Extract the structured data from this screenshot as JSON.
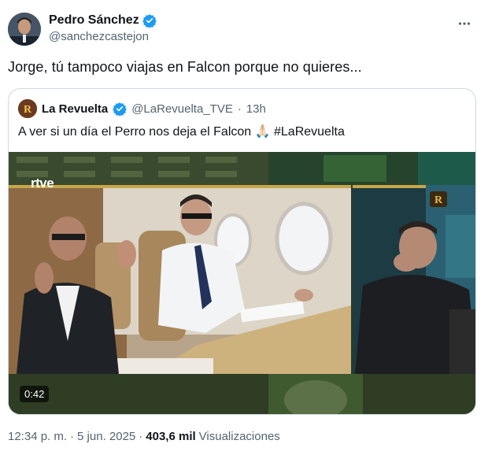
{
  "author": {
    "name": "Pedro Sánchez",
    "handle": "@sanchezcastejon",
    "verified_icon": "verified-badge-icon"
  },
  "tweet": {
    "text": "Jorge, tú tampoco viajas en Falcon porque no quieres..."
  },
  "quote": {
    "name": "La Revuelta",
    "handle": "@LaRevuelta_TVE",
    "separator": "·",
    "time": "13h",
    "text_main": "A ver si un día el Perro nos deja el Falcon",
    "emoji": "🙏🏻",
    "hashtag": "#LaRevuelta",
    "media": {
      "watermark": "rtve",
      "duration": "0:42"
    }
  },
  "footer": {
    "time": "12:34 p. m.",
    "sep1": "·",
    "date": "5 jun. 2025",
    "sep2": "·",
    "views_count": "403,6 mil",
    "views_label": "Visualizaciones"
  },
  "colors": {
    "text_primary": "#0f1419",
    "text_secondary": "#536471",
    "verified_blue": "#1d9bf0",
    "border": "#cfd9de"
  }
}
